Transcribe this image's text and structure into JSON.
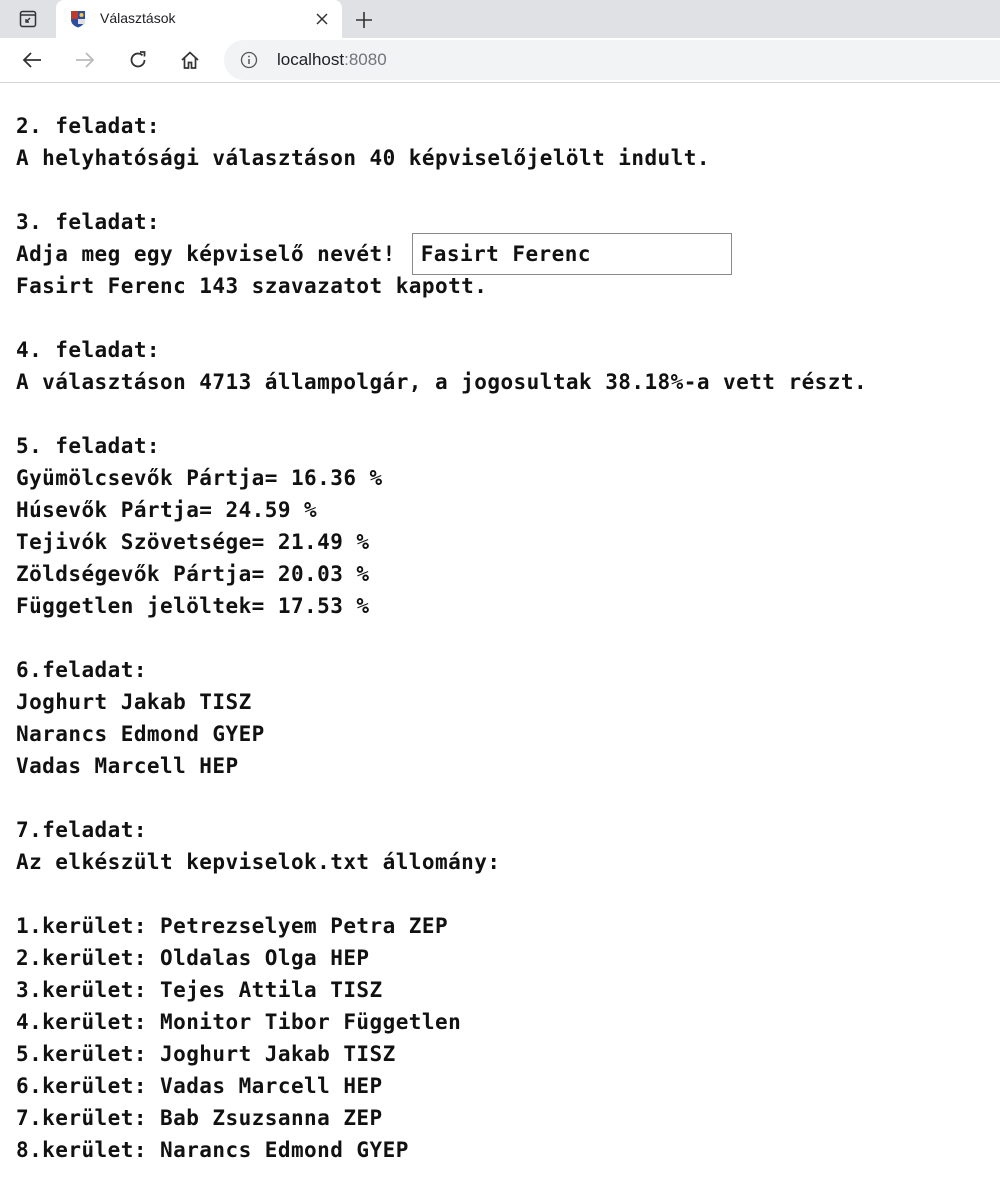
{
  "browser": {
    "tab_title": "Választások",
    "url_host": "localhost",
    "url_port": ":8080"
  },
  "page": {
    "task2_heading": "2. feladat:",
    "task2_text": "A helyhatósági választáson 40 képviselőjelölt indult.",
    "task3_heading": "3. feladat:",
    "task3_prompt": "Adja meg egy képviselő nevét!",
    "task3_input_value": "Fasirt Ferenc",
    "task3_result": "Fasirt Ferenc 143 szavazatot kapott.",
    "task4_heading": "4. feladat:",
    "task4_text": "A választáson 4713 állampolgár, a jogosultak 38.18%-a vett részt.",
    "task5_heading": "5. feladat:",
    "task5_lines": [
      "Gyümölcsevők Pártja= 16.36 %",
      "Húsevők Pártja= 24.59 %",
      "Tejivók Szövetsége= 21.49 %",
      "Zöldségevők Pártja= 20.03 %",
      "Független jelöltek= 17.53 %"
    ],
    "task6_heading": "6.feladat:",
    "task6_lines": [
      "Joghurt Jakab TISZ",
      "Narancs Edmond GYEP",
      "Vadas Marcell HEP"
    ],
    "task7_heading": "7.feladat:",
    "task7_text": "Az elkészült kepviselok.txt állomány:",
    "task7_lines": [
      "1.kerület: Petrezselyem Petra ZEP",
      "2.kerület: Oldalas Olga HEP",
      "3.kerület: Tejes Attila TISZ",
      "4.kerület: Monitor Tibor Független",
      "5.kerület: Joghurt Jakab TISZ",
      "6.kerület: Vadas Marcell HEP",
      "7.kerület: Bab Zsuzsanna ZEP",
      "8.kerület: Narancs Edmond GYEP"
    ]
  }
}
